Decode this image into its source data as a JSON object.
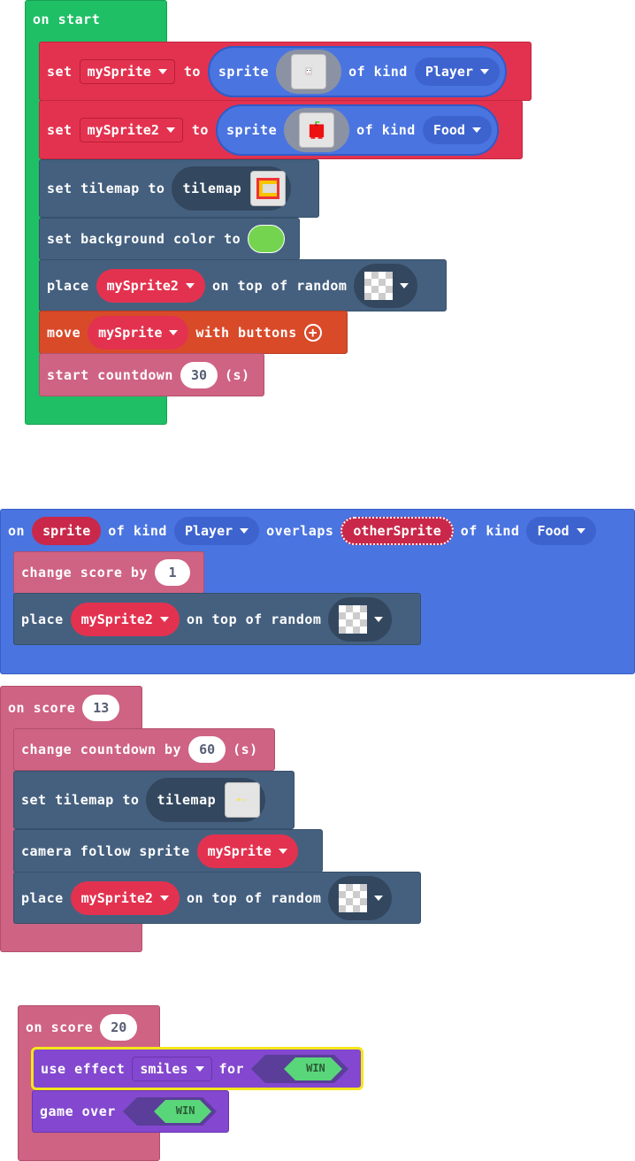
{
  "on_start": {
    "hat_label": "on start",
    "set1": {
      "set": "set",
      "var": "mySprite",
      "to": "to",
      "sprite": "sprite",
      "of_kind": "of kind",
      "kind": "Player"
    },
    "set2": {
      "set": "set",
      "var": "mySprite2",
      "to": "to",
      "sprite": "sprite",
      "of_kind": "of kind",
      "kind": "Food"
    },
    "tilemap": {
      "label": "set tilemap to",
      "value": "tilemap"
    },
    "bg": {
      "label": "set background color to",
      "color": "#75d44f"
    },
    "place": {
      "place": "place",
      "var": "mySprite2",
      "on_top": "on top of random"
    },
    "move": {
      "move": "move",
      "var": "mySprite",
      "with": "with buttons"
    },
    "countdown": {
      "label": "start countdown",
      "value": "30",
      "unit": "(s)"
    }
  },
  "overlap": {
    "on": "on",
    "sprite": "sprite",
    "of_kind": "of kind",
    "kind1": "Player",
    "overlaps": "overlaps",
    "other": "otherSprite",
    "of_kind2": "of kind",
    "kind2": "Food",
    "change_score": {
      "label": "change score by",
      "value": "1"
    },
    "place": {
      "place": "place",
      "var": "mySprite2",
      "on_top": "on top of random"
    }
  },
  "score13": {
    "label": "on score",
    "value": "13",
    "countdown": {
      "label": "change countdown by",
      "value": "60",
      "unit": "(s)"
    },
    "tilemap": {
      "label": "set tilemap to",
      "value": "tilemap"
    },
    "camera": {
      "label": "camera follow sprite",
      "var": "mySprite"
    },
    "place": {
      "place": "place",
      "var": "mySprite2",
      "on_top": "on top of random"
    }
  },
  "score20": {
    "label": "on score",
    "value": "20",
    "effect": {
      "use": "use effect",
      "effect": "smiles",
      "for": "for",
      "win": "WIN"
    },
    "game_over": {
      "label": "game over",
      "win": "WIN"
    }
  },
  "colors": {
    "green": "#1fbf66",
    "red": "#e3324f",
    "blue": "#4a74e0",
    "slate": "#45607f",
    "orange": "#d94a29",
    "pink": "#cf6383",
    "purple": "#8348cf",
    "win": "#5ad67a"
  }
}
